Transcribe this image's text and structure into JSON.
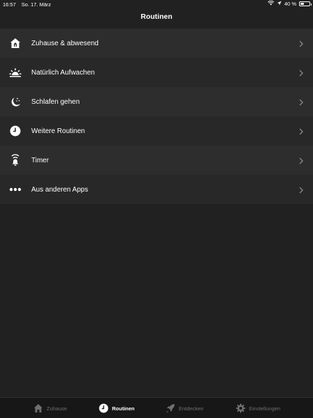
{
  "status_bar": {
    "time": "16:57",
    "date": "So. 17. März",
    "battery": "40 %",
    "battery_level": 0.4
  },
  "nav": {
    "title": "Routinen"
  },
  "routines": [
    {
      "label": "Zuhause & abwesend",
      "icon": "home-icon"
    },
    {
      "label": "Natürlich Aufwachen",
      "icon": "sunrise-icon"
    },
    {
      "label": "Schlafen gehen",
      "icon": "moon-stars-icon"
    },
    {
      "label": "Weitere Routinen",
      "icon": "clock-icon"
    },
    {
      "label": "Timer",
      "icon": "timer-icon"
    },
    {
      "label": "Aus anderen Apps",
      "icon": "more-dots-icon"
    }
  ],
  "tabs": [
    {
      "label": "Zuhause",
      "icon": "home-icon",
      "active": false
    },
    {
      "label": "Routinen",
      "icon": "clock-icon",
      "active": true
    },
    {
      "label": "Entdecken",
      "icon": "rocket-icon",
      "active": false
    },
    {
      "label": "Einstellungen",
      "icon": "gear-icon",
      "active": false
    }
  ],
  "colors": {
    "background": "#212121",
    "row_odd": "#2d2d2d",
    "row_even": "#282828",
    "tab_inactive": "#6f6f6f",
    "tab_active": "#ffffff"
  }
}
